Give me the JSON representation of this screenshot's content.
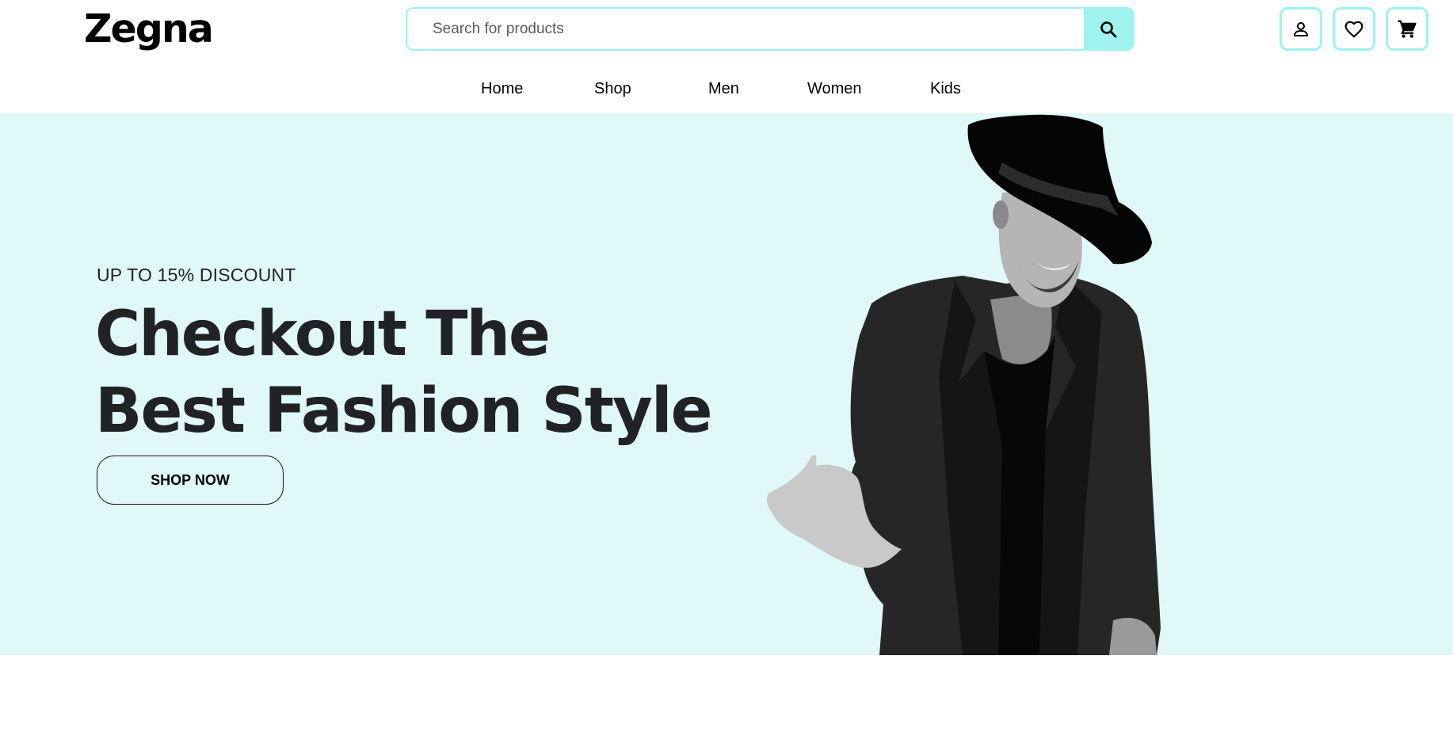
{
  "header": {
    "logo": "Zegna",
    "search": {
      "placeholder": "Search for products",
      "value": ""
    }
  },
  "header_icons": [
    "user-icon",
    "heart-icon",
    "cart-icon"
  ],
  "nav": {
    "items": [
      "Home",
      "Shop",
      "Men",
      "Women",
      "Kids"
    ]
  },
  "hero": {
    "subtitle": "UP TO 15% DISCOUNT",
    "title_line1": "Checkout The",
    "title_line2": "Best Fashion Style",
    "cta_label": "SHOP NOW"
  },
  "colors": {
    "accent": "#9ef3ef",
    "hero_bg": "#e0f9f8",
    "text_dark": "#202226"
  }
}
